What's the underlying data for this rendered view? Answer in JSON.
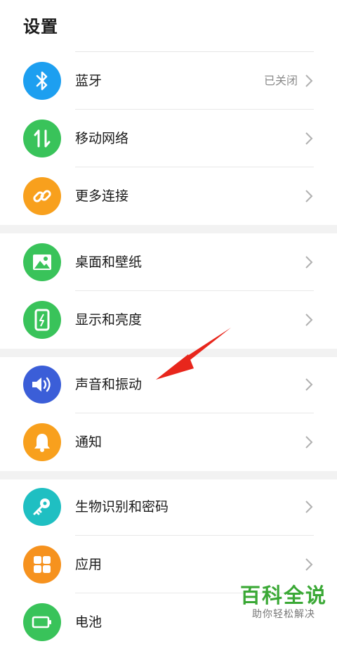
{
  "page": {
    "title": "设置"
  },
  "colors": {
    "bluetooth": "#1d9ff0",
    "mobile_network": "#39c35a",
    "more_connections": "#f8a01d",
    "wallpaper": "#39c35a",
    "display": "#39c35a",
    "sound": "#3b5ed8",
    "notifications": "#f8a01d",
    "biometrics": "#1fbfc2",
    "apps": "#f6921e",
    "battery": "#39c35a",
    "annotation_arrow": "#e8261c"
  },
  "settings": {
    "bluetooth": {
      "label": "蓝牙",
      "status": "已关闭",
      "icon": "bluetooth-icon"
    },
    "mobile_network": {
      "label": "移动网络",
      "icon": "mobile-data-icon"
    },
    "more_connections": {
      "label": "更多连接",
      "icon": "link-icon"
    },
    "wallpaper": {
      "label": "桌面和壁纸",
      "icon": "image-icon"
    },
    "display": {
      "label": "显示和亮度",
      "icon": "phone-brightness-icon"
    },
    "sound": {
      "label": "声音和振动",
      "icon": "speaker-icon"
    },
    "notifications": {
      "label": "通知",
      "icon": "bell-icon"
    },
    "biometrics": {
      "label": "生物识别和密码",
      "icon": "key-icon"
    },
    "apps": {
      "label": "应用",
      "icon": "apps-grid-icon"
    },
    "battery": {
      "label": "电池",
      "icon": "battery-icon"
    }
  },
  "watermark": {
    "title": "百科全说",
    "subtitle": "助你轻松解决"
  }
}
